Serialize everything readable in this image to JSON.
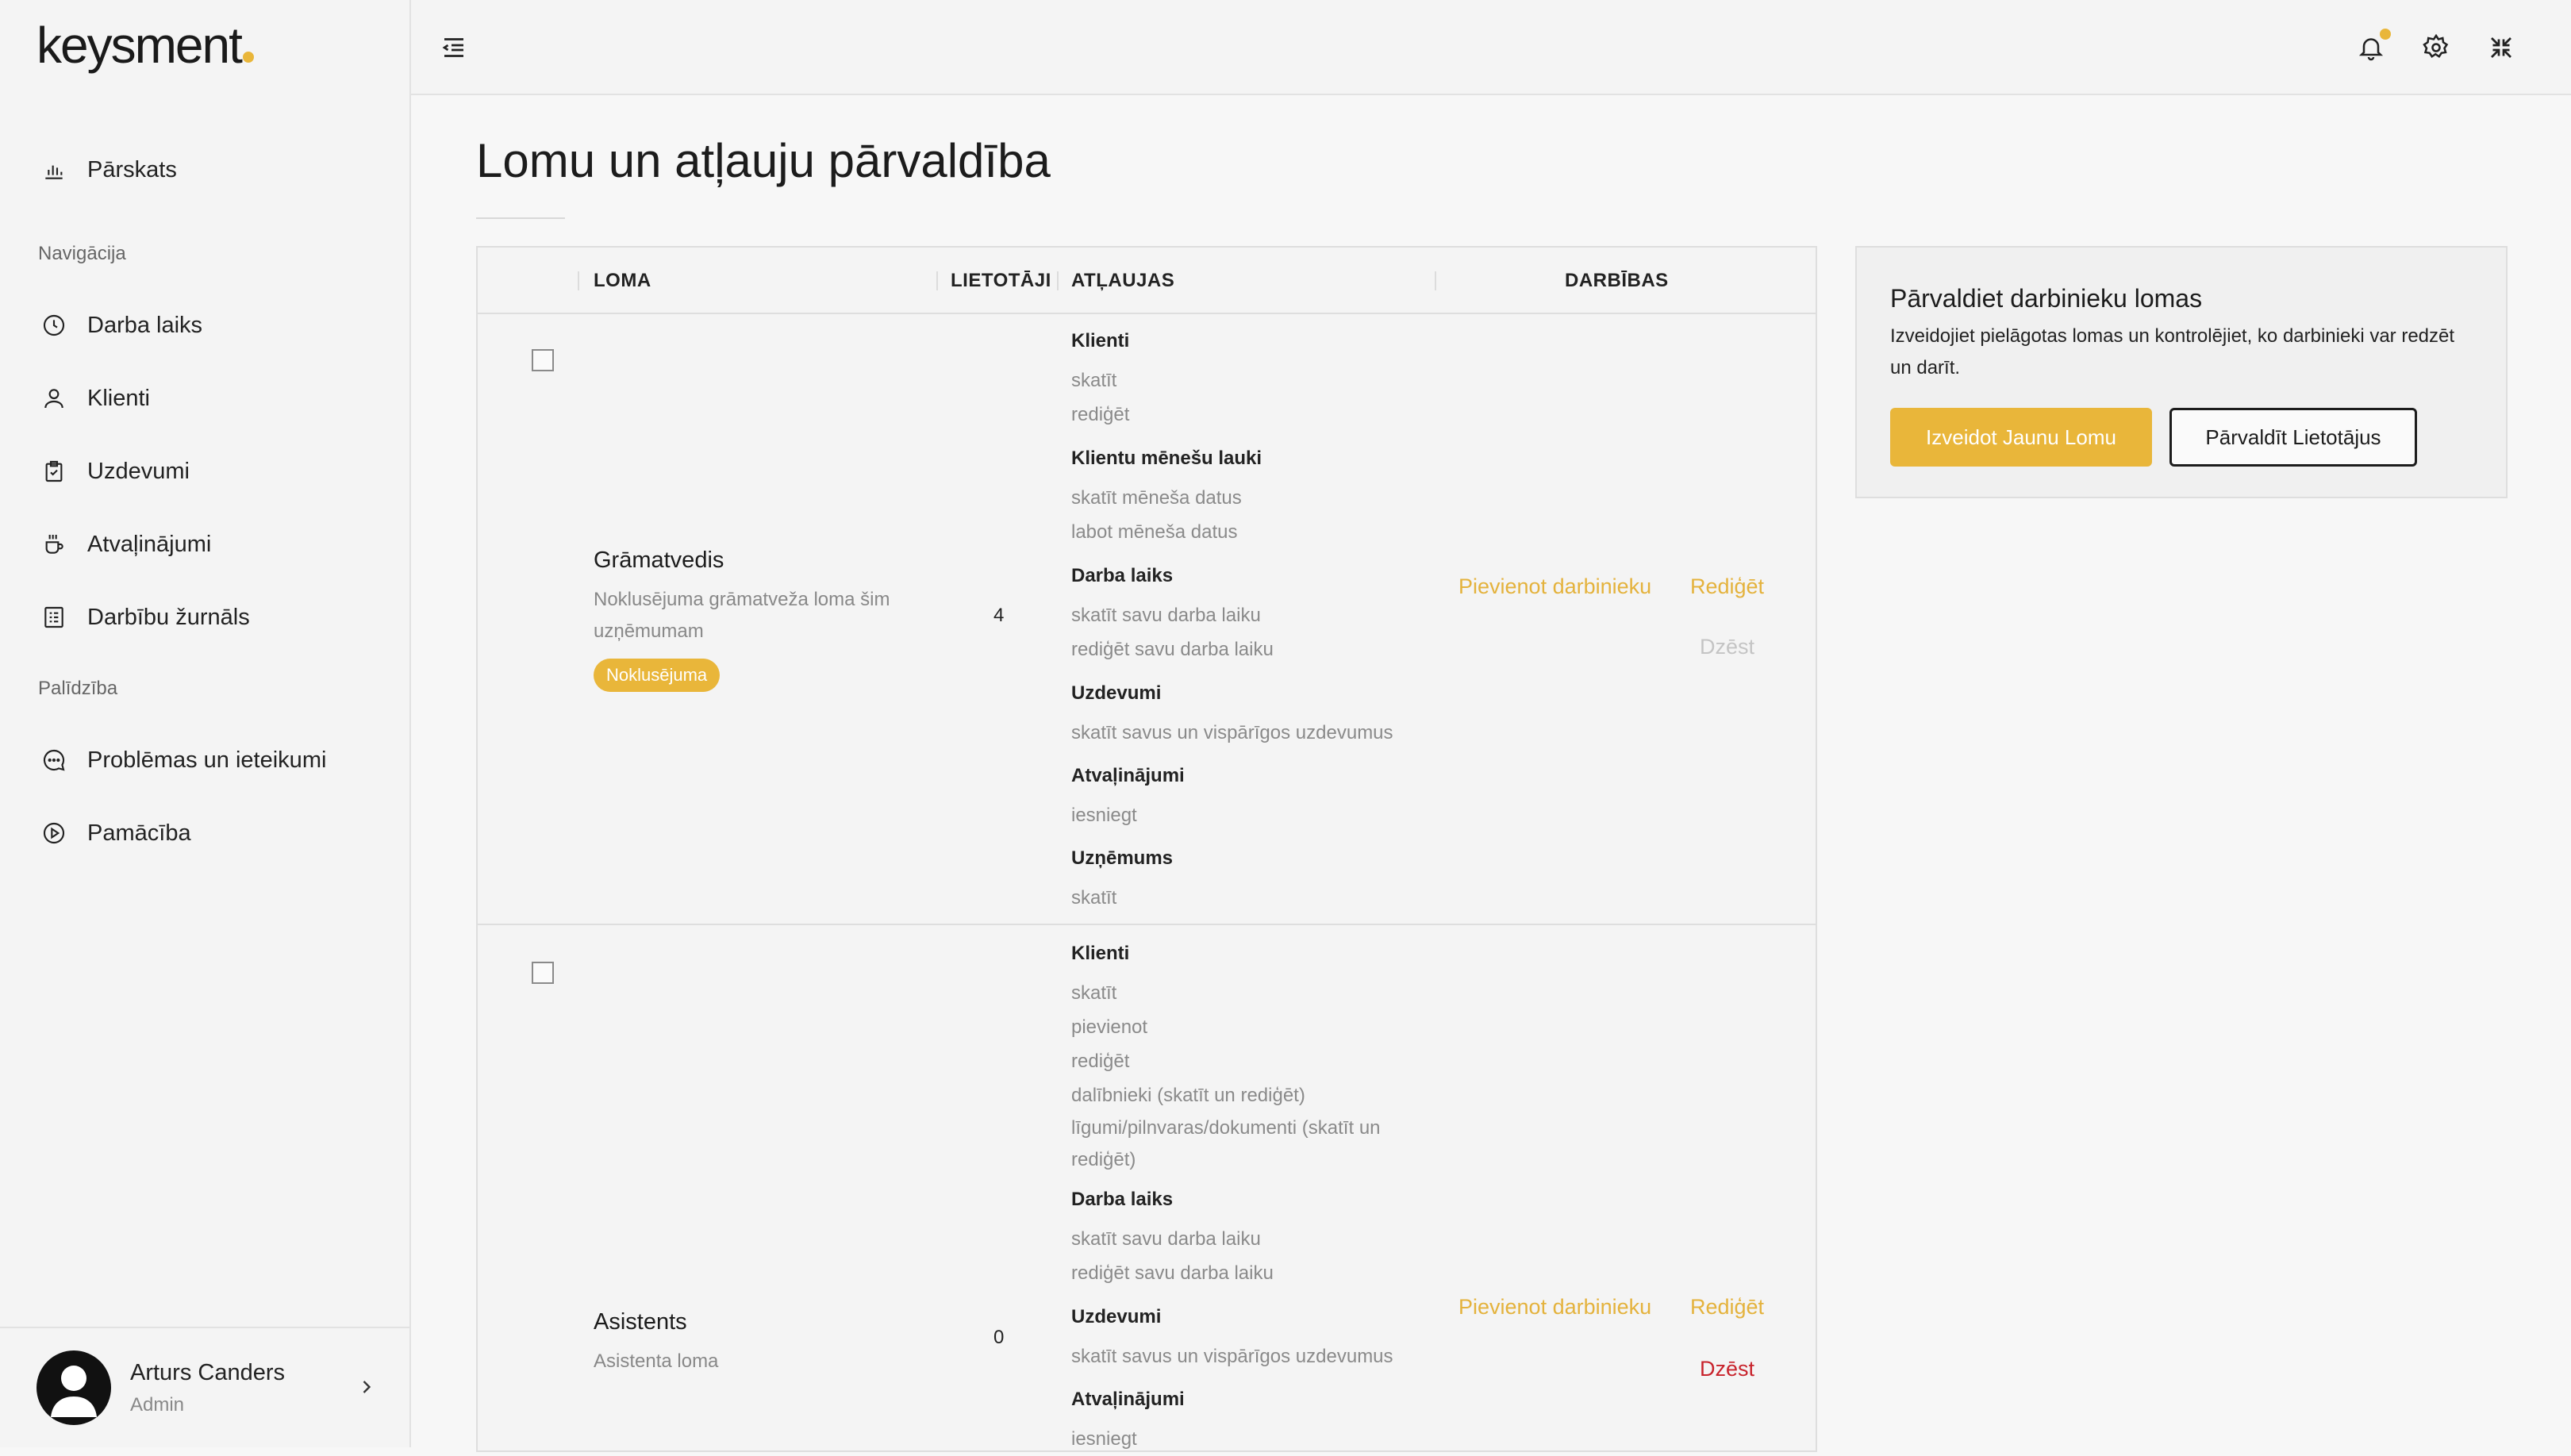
{
  "app": {
    "logo": "keysment"
  },
  "sidebar": {
    "overview": {
      "label": "Pārskats"
    },
    "section_navigation": "Navigācija",
    "items": [
      {
        "label": "Darba laiks",
        "icon": "clock-icon"
      },
      {
        "label": "Klienti",
        "icon": "user-icon"
      },
      {
        "label": "Uzdevumi",
        "icon": "clipboard-icon"
      },
      {
        "label": "Atvaļinājumi",
        "icon": "coffee-icon"
      },
      {
        "label": "Darbību žurnāls",
        "icon": "log-icon"
      }
    ],
    "section_help": "Palīdzība",
    "help_items": [
      {
        "label": "Problēmas un ieteikumi",
        "icon": "chat-icon"
      },
      {
        "label": "Pamācība",
        "icon": "play-icon"
      }
    ],
    "user": {
      "name": "Arturs Canders",
      "role": "Admin"
    }
  },
  "page": {
    "title": "Lomu un atļauju pārvaldība"
  },
  "table": {
    "headers": {
      "role": "LOMA",
      "users": "LIETOTĀJI",
      "permissions": "ATĻAUJAS",
      "actions": "DARBĪBAS"
    },
    "rows": [
      {
        "name": "Grāmatvedis",
        "description": "Noklusējuma grāmatveža loma šim uzņēmumam",
        "badge": "Noklusējuma",
        "users": "4",
        "permissions": [
          {
            "title": "Klienti",
            "items": [
              "skatīt",
              "rediģēt"
            ]
          },
          {
            "title": "Klientu mēnešu lauki",
            "items": [
              "skatīt mēneša datus",
              "labot mēneša datus"
            ]
          },
          {
            "title": "Darba laiks",
            "items": [
              "skatīt savu darba laiku",
              "rediģēt savu darba laiku"
            ]
          },
          {
            "title": "Uzdevumi",
            "items": [
              "skatīt savus un vispārīgos uzdevumus"
            ]
          },
          {
            "title": "Atvaļinājumi",
            "items": [
              "iesniegt"
            ]
          },
          {
            "title": "Uzņēmums",
            "items": [
              "skatīt"
            ]
          }
        ],
        "actions": {
          "add_employee": "Pievienot darbinieku",
          "edit": "Rediģēt",
          "delete": "Dzēst",
          "delete_enabled": false
        }
      },
      {
        "name": "Asistents",
        "description": "Asistenta loma",
        "users": "0",
        "permissions": [
          {
            "title": "Klienti",
            "items": [
              "skatīt",
              "pievienot",
              "rediģēt",
              "dalībnieki (skatīt un rediģēt)",
              "līgumi/pilnvaras/dokumenti (skatīt un rediģēt)"
            ]
          },
          {
            "title": "Darba laiks",
            "items": [
              "skatīt savu darba laiku",
              "rediģēt savu darba laiku"
            ]
          },
          {
            "title": "Uzdevumi",
            "items": [
              "skatīt savus un vispārīgos uzdevumus"
            ]
          },
          {
            "title": "Atvaļinājumi",
            "items": [
              "iesniegt"
            ]
          }
        ],
        "actions": {
          "add_employee": "Pievienot darbinieku",
          "edit": "Rediģēt",
          "delete": "Dzēst",
          "delete_enabled": true
        }
      }
    ]
  },
  "card": {
    "title": "Pārvaldiet darbinieku lomas",
    "text": "Izveidojiet pielāgotas lomas un kontrolējiet, ko darbinieki var redzēt un darīt.",
    "primary_button": "Izveidot Jaunu Lomu",
    "secondary_button": "Pārvaldīt Lietotājus"
  },
  "colors": {
    "accent": "#e9b63a",
    "danger": "#c8232c",
    "muted": "#8a8a8a"
  }
}
